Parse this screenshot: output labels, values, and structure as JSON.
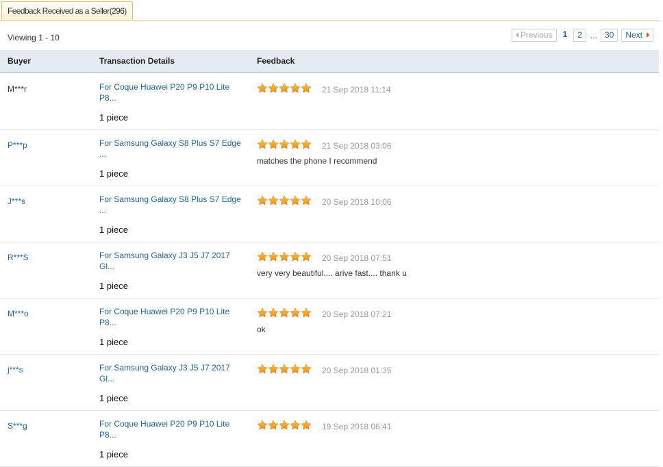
{
  "tab": {
    "label": "Feedback Received as a Seller(296)"
  },
  "viewing": "Viewing 1 - 10",
  "pager": {
    "previous": "Previous",
    "page1": "1",
    "page2": "2",
    "ellipsis": "...",
    "last": "30",
    "next": "Next"
  },
  "table": {
    "headers": {
      "buyer": "Buyer",
      "details": "Transaction Details",
      "feedback": "Feedback"
    },
    "rows": [
      {
        "buyer": "M***r",
        "buyer_link": false,
        "product": "For Coque Huawei P20 P9 P10 Lite P8...",
        "quantity": "1 piece",
        "stars": 5,
        "date": "21 Sep 2018 11:14",
        "comment": ""
      },
      {
        "buyer": "P***p",
        "buyer_link": true,
        "product": "For Samsung Galaxy S8 Plus S7 Edge ...",
        "quantity": "1 piece",
        "stars": 5,
        "date": "21 Sep 2018 03:06",
        "comment": "matches the phone I recommend"
      },
      {
        "buyer": "J***s",
        "buyer_link": true,
        "product": "For Samsung Galaxy S8 Plus S7 Edge ...",
        "quantity": "1 piece",
        "stars": 5,
        "date": "20 Sep 2018 10:06",
        "comment": ""
      },
      {
        "buyer": "R***S",
        "buyer_link": true,
        "product": "For Samsung Galaxy J3 J5 J7 2017 Gl...",
        "quantity": "1 piece",
        "stars": 5,
        "date": "20 Sep 2018 07:51",
        "comment": "very very beautiful.... arive fast.... thank u"
      },
      {
        "buyer": "M***o",
        "buyer_link": true,
        "product": "For Coque Huawei P20 P9 P10 Lite P8...",
        "quantity": "1 piece",
        "stars": 5,
        "date": "20 Sep 2018 07:21",
        "comment": "ok"
      },
      {
        "buyer": "j***s",
        "buyer_link": true,
        "product": "For Samsung Galaxy J3 J5 J7 2017 Gl...",
        "quantity": "1 piece",
        "stars": 5,
        "date": "20 Sep 2018 01:35",
        "comment": ""
      },
      {
        "buyer": "S***g",
        "buyer_link": true,
        "product": "For Coque Huawei P20 P9 P10 Lite P8...",
        "quantity": "1 piece",
        "stars": 5,
        "date": "19 Sep 2018 06:41",
        "comment": ""
      }
    ]
  },
  "colors": {
    "link": "#1a64a8",
    "star": "#f39a1d",
    "tab_border": "#e8b963",
    "header_bg": "#e6eaf1"
  },
  "icons": {
    "star": "star-icon",
    "prev": "triangle-left-icon",
    "next": "triangle-right-icon"
  }
}
